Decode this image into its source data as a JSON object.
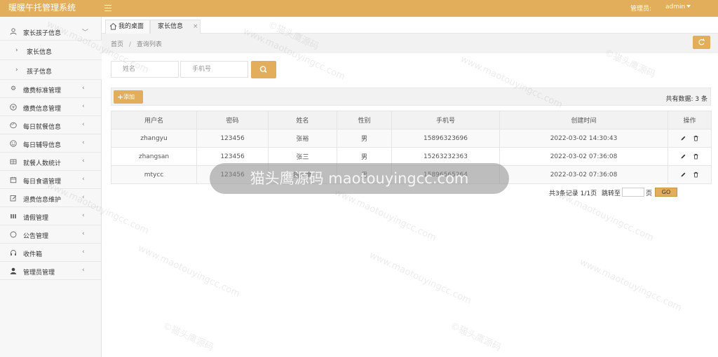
{
  "app": {
    "title": "暖暖午托管理系统",
    "admin_label": "管理员:",
    "admin_name": "admin"
  },
  "sidebar": {
    "items": [
      {
        "label": "家长孩子信息",
        "icon": "user-icon",
        "expanded": true
      },
      {
        "label": "缴费标准管理",
        "icon": "gear-icon"
      },
      {
        "label": "缴费信息管理",
        "icon": "yen-icon"
      },
      {
        "label": "每日就餐信息",
        "icon": "palette-icon"
      },
      {
        "label": "每日辅导信息",
        "icon": "smile-icon"
      },
      {
        "label": "就餐人数统计",
        "icon": "table-icon"
      },
      {
        "label": "每日食谱管理",
        "icon": "calendar-icon"
      },
      {
        "label": "退费信息维护",
        "icon": "edit-icon"
      },
      {
        "label": "请假管理",
        "icon": "grid-icon"
      },
      {
        "label": "公告管理",
        "icon": "circle-icon"
      },
      {
        "label": "收件箱",
        "icon": "headset-icon"
      },
      {
        "label": "管理员管理",
        "icon": "person-icon"
      }
    ],
    "sub_items": [
      {
        "label": "家长信息"
      },
      {
        "label": "孩子信息"
      }
    ]
  },
  "tabs": [
    {
      "label": "我的桌面"
    },
    {
      "label": "家长信息"
    }
  ],
  "breadcrumb": {
    "home": "首页",
    "sep": "/",
    "current": "查询列表"
  },
  "search": {
    "name_placeholder": "姓名",
    "phone_placeholder": "手机号"
  },
  "toolbar": {
    "add_label": "添加",
    "total_text": "共有数据: 3 条"
  },
  "table": {
    "columns": [
      "用户名",
      "密码",
      "姓名",
      "性别",
      "手机号",
      "创建时间",
      "操作"
    ],
    "rows": [
      [
        "zhangyu",
        "123456",
        "张裕",
        "男",
        "15896323696",
        "2022-03-02 14:30:43"
      ],
      [
        "zhangsan",
        "123456",
        "张三",
        "男",
        "15263232363",
        "2022-03-02 07:36:08"
      ],
      [
        "mtycc",
        "123456",
        "猫头鹰",
        "男",
        "15896565264",
        "2022-03-02 07:36:08"
      ]
    ]
  },
  "pager": {
    "summary": "共3条记录  1/1页",
    "jump_label": "跳转至",
    "page_unit": "页",
    "go_label": "GO"
  },
  "watermark": {
    "text": "www.maotouyingcc.com",
    "logo_text": "©猫头鹰源码",
    "banner": "猫头鹰源码 maotouyingcc.com"
  },
  "colors": {
    "accent": "#e3ae5b",
    "sidebar_bg": "#f7f7f7",
    "header_bg": "#f2f2f2"
  }
}
